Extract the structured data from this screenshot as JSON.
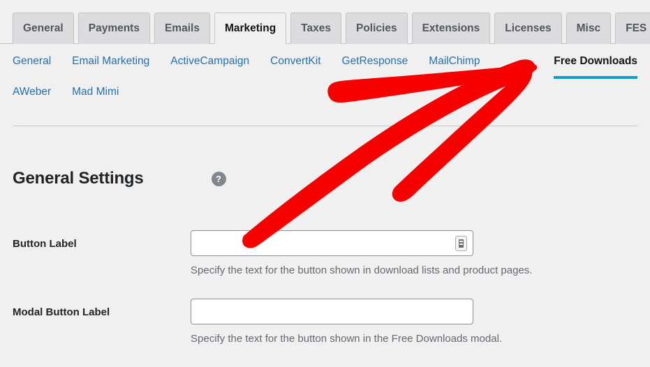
{
  "primary_tabs": [
    {
      "label": "General",
      "active": false
    },
    {
      "label": "Payments",
      "active": false
    },
    {
      "label": "Emails",
      "active": false
    },
    {
      "label": "Marketing",
      "active": true
    },
    {
      "label": "Taxes",
      "active": false
    },
    {
      "label": "Policies",
      "active": false
    },
    {
      "label": "Extensions",
      "active": false
    },
    {
      "label": "Licenses",
      "active": false
    },
    {
      "label": "Misc",
      "active": false
    },
    {
      "label": "FES",
      "active": false
    }
  ],
  "sub_nav": {
    "items": [
      {
        "label": "General"
      },
      {
        "label": "Email Marketing"
      },
      {
        "label": "ActiveCampaign"
      },
      {
        "label": "ConvertKit"
      },
      {
        "label": "GetResponse"
      },
      {
        "label": "MailChimp"
      },
      {
        "label": "AWeber"
      },
      {
        "label": "Mad Mimi"
      }
    ],
    "current": {
      "label": "Free Downloads"
    }
  },
  "section": {
    "title": "General Settings",
    "help_icon": "question-mark-icon",
    "help_glyph": "?"
  },
  "fields": [
    {
      "label": "Button Label",
      "value": "",
      "placeholder": "",
      "description": "Specify the text for the button shown in download lists and product pages.",
      "has_autofill_icon": true
    },
    {
      "label": "Modal Button Label",
      "value": "",
      "placeholder": "",
      "description": "Specify the text for the button shown in the Free Downloads modal.",
      "has_autofill_icon": false
    }
  ],
  "annotation": {
    "type": "arrow",
    "color": "#f70000",
    "points_to": "Free Downloads"
  },
  "colors": {
    "page_background": "#f0f0f1",
    "link_blue": "#2271b1",
    "active_underline": "#0b9dd0",
    "tab_inactive_background": "#dcdcde",
    "annotation_red": "#f70000"
  }
}
